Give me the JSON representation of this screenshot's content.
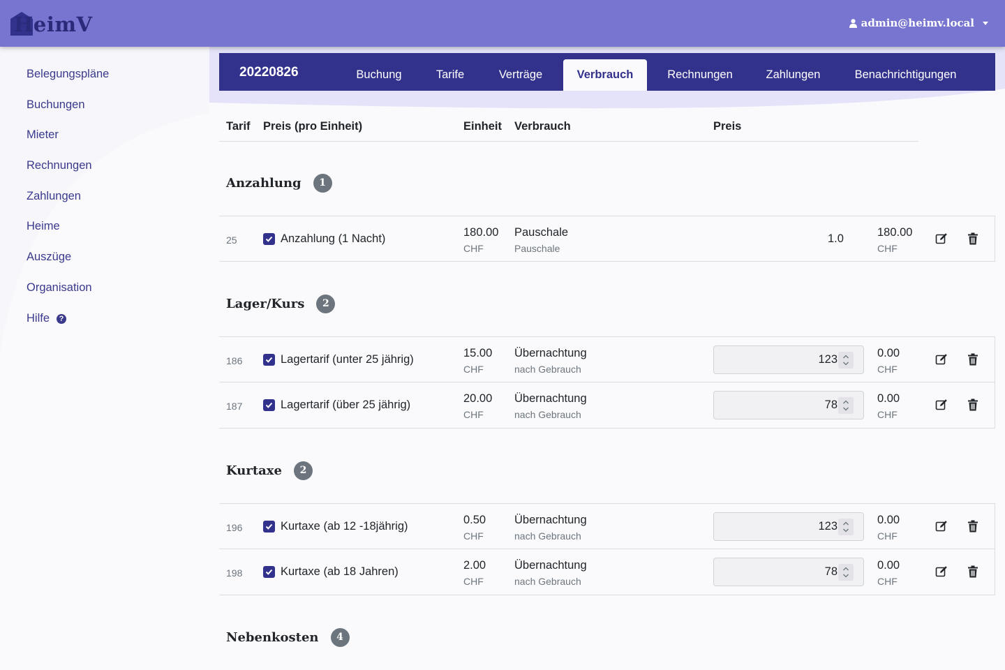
{
  "navbar": {
    "logo_text": "HeimV",
    "user_email": "admin@heimv.local",
    "user_icon": "user-icon"
  },
  "sidebar": {
    "items": [
      {
        "label": "Belegungspläne"
      },
      {
        "label": "Buchungen"
      },
      {
        "label": "Mieter"
      },
      {
        "label": "Rechnungen"
      },
      {
        "label": "Zahlungen"
      },
      {
        "label": "Heime"
      },
      {
        "label": "Auszüge"
      },
      {
        "label": "Organisation"
      },
      {
        "label": "Hilfe",
        "icon": "question-circle-icon"
      }
    ]
  },
  "booking": {
    "ref": "20220826",
    "tabs": [
      {
        "label": "Buchung",
        "active": false
      },
      {
        "label": "Tarife",
        "active": false
      },
      {
        "label": "Verträge",
        "active": false
      },
      {
        "label": "Verbrauch",
        "active": true
      },
      {
        "label": "Rechnungen",
        "active": false
      },
      {
        "label": "Zahlungen",
        "active": false
      },
      {
        "label": "Benachrichtigungen",
        "active": false
      }
    ]
  },
  "table": {
    "headers": {
      "tarif": "Tarif",
      "preis_einheit": "Preis (pro Einheit)",
      "einheit": "Einheit",
      "verbrauch": "Verbrauch",
      "preis": "Preis"
    },
    "groups": [
      {
        "title": "Anzahlung",
        "count": "1",
        "rows": [
          {
            "id": "25",
            "name": "Anzahlung (1 Nacht)",
            "price": "180.00",
            "currency": "CHF",
            "unit": "Pauschale",
            "unit_sub": "Pauschale",
            "qty": "1.0",
            "qty_editable": false,
            "total": "180.00",
            "total_currency": "CHF"
          }
        ]
      },
      {
        "title": "Lager/Kurs",
        "count": "2",
        "rows": [
          {
            "id": "186",
            "name": "Lagertarif (unter 25 jährig)",
            "price": "15.00",
            "currency": "CHF",
            "unit": "Übernachtung",
            "unit_sub": "nach Gebrauch",
            "qty": "123",
            "qty_editable": true,
            "total": "0.00",
            "total_currency": "CHF"
          },
          {
            "id": "187",
            "name": "Lagertarif (über 25 jährig)",
            "price": "20.00",
            "currency": "CHF",
            "unit": "Übernachtung",
            "unit_sub": "nach Gebrauch",
            "qty": "78",
            "qty_editable": true,
            "total": "0.00",
            "total_currency": "CHF"
          }
        ]
      },
      {
        "title": "Kurtaxe",
        "count": "2",
        "rows": [
          {
            "id": "196",
            "name": "Kurtaxe (ab 12 -18jährig)",
            "price": "0.50",
            "currency": "CHF",
            "unit": "Übernachtung",
            "unit_sub": "nach Gebrauch",
            "qty": "123",
            "qty_editable": true,
            "total": "0.00",
            "total_currency": "CHF"
          },
          {
            "id": "198",
            "name": "Kurtaxe (ab 18 Jahren)",
            "price": "2.00",
            "currency": "CHF",
            "unit": "Übernachtung",
            "unit_sub": "nach Gebrauch",
            "qty": "78",
            "qty_editable": true,
            "total": "0.00",
            "total_currency": "CHF"
          }
        ]
      },
      {
        "title": "Nebenkosten",
        "count": "4",
        "rows": []
      }
    ]
  },
  "colors": {
    "navbar": "#7775cf",
    "primary": "#32318c",
    "badge": "#6c757d"
  }
}
